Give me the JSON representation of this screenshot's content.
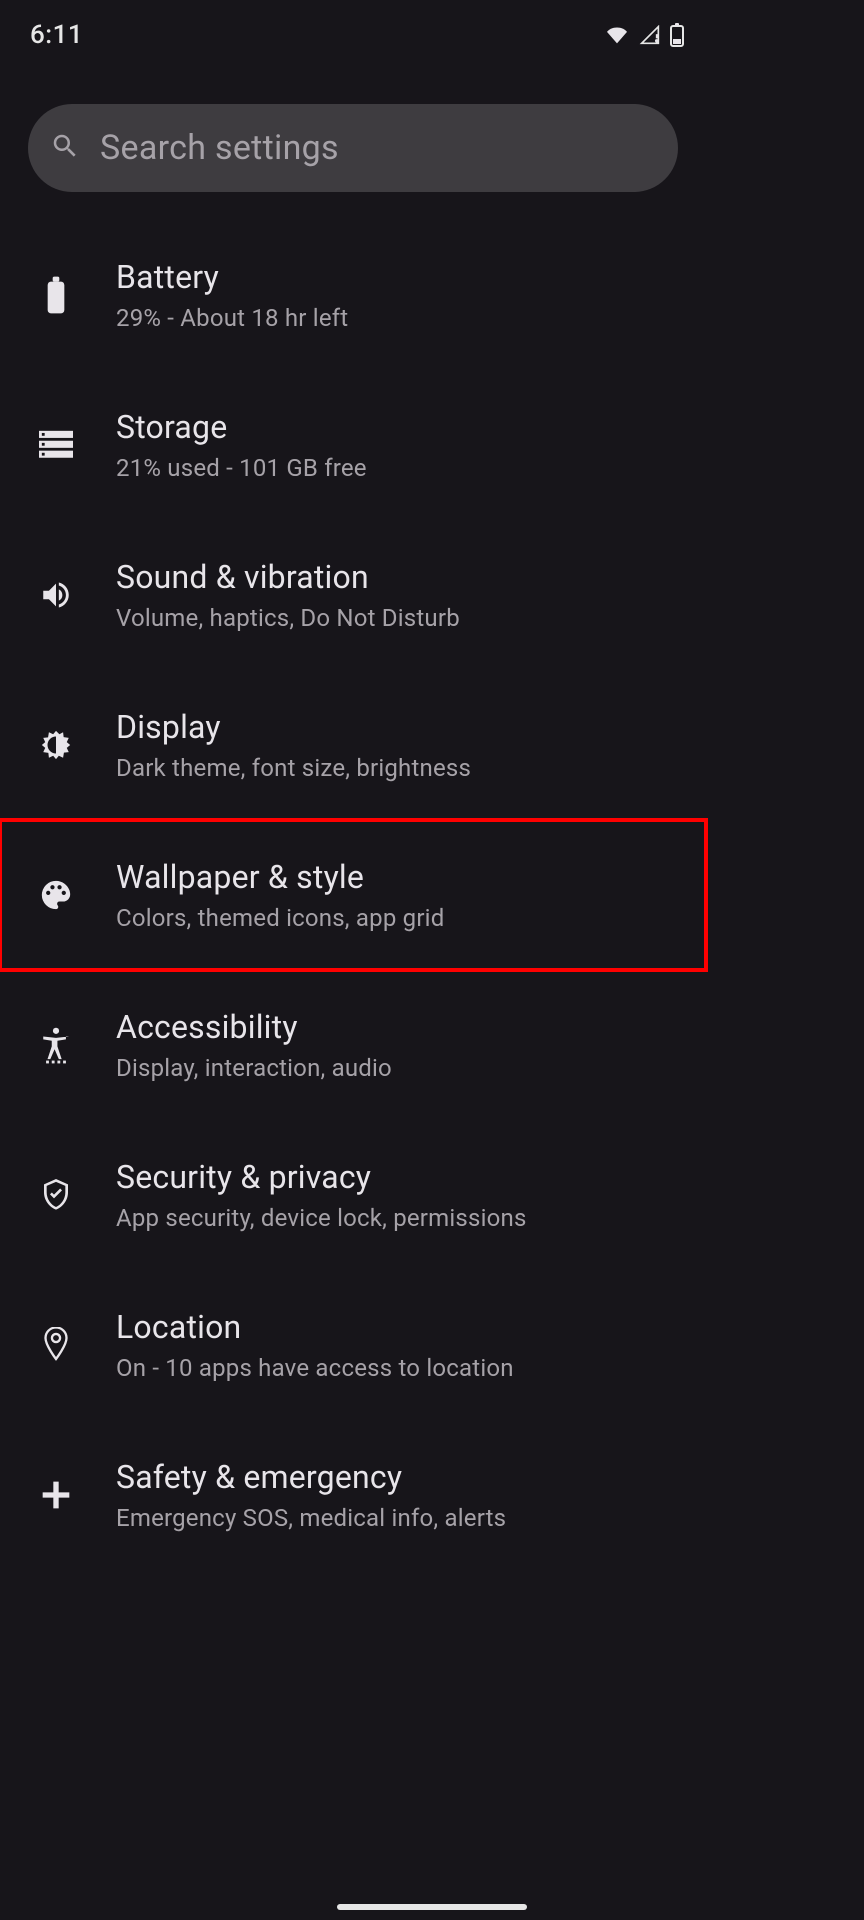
{
  "statusbar": {
    "time": "6:11"
  },
  "search": {
    "placeholder": "Search settings"
  },
  "items": [
    {
      "icon": "battery-icon",
      "title": "Battery",
      "subtitle": "29% - About 18 hr left",
      "highlight": false
    },
    {
      "icon": "storage-icon",
      "title": "Storage",
      "subtitle": "21% used - 101 GB free",
      "highlight": false
    },
    {
      "icon": "sound-icon",
      "title": "Sound & vibration",
      "subtitle": "Volume, haptics, Do Not Disturb",
      "highlight": false
    },
    {
      "icon": "display-icon",
      "title": "Display",
      "subtitle": "Dark theme, font size, brightness",
      "highlight": false
    },
    {
      "icon": "palette-icon",
      "title": "Wallpaper & style",
      "subtitle": "Colors, themed icons, app grid",
      "highlight": true
    },
    {
      "icon": "accessibility-icon",
      "title": "Accessibility",
      "subtitle": "Display, interaction, audio",
      "highlight": false
    },
    {
      "icon": "security-icon",
      "title": "Security & privacy",
      "subtitle": "App security, device lock, permissions",
      "highlight": false
    },
    {
      "icon": "location-icon",
      "title": "Location",
      "subtitle": "On - 10 apps have access to location",
      "highlight": false
    },
    {
      "icon": "safety-icon",
      "title": "Safety & emergency",
      "subtitle": "Emergency SOS, medical info, alerts",
      "highlight": false
    }
  ]
}
